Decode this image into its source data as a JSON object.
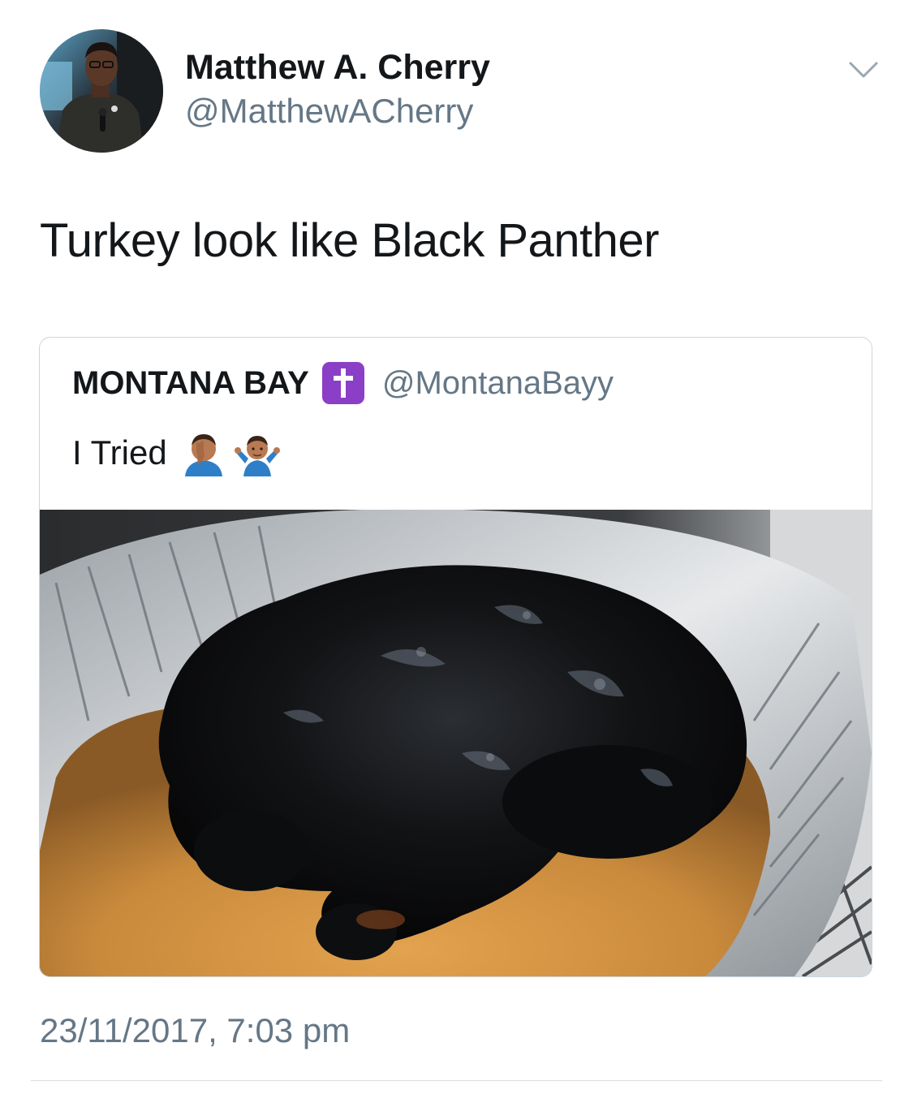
{
  "tweet": {
    "author": {
      "name": "Matthew A. Cherry",
      "handle": "@MatthewACherry"
    },
    "text": "Turkey look like Black Panther",
    "timestamp": "23/11/2017, 7:03 pm",
    "menu_icon": "chevron-down-icon"
  },
  "quoted_tweet": {
    "author": {
      "name": "MONTANA BAY",
      "badge": "✝",
      "badge_icon": "latin-cross-emoji-icon",
      "handle": "@MontanaBayy"
    },
    "text": "I Tried",
    "emoji_icons": [
      "face-palm-emoji-icon",
      "shrug-emoji-icon"
    ],
    "media": "burnt-turkey-photo"
  },
  "colors": {
    "primary_text": "#14171a",
    "secondary_text": "#657786",
    "border": "#ccd6dd",
    "badge_purple": "#8a3fc6"
  }
}
